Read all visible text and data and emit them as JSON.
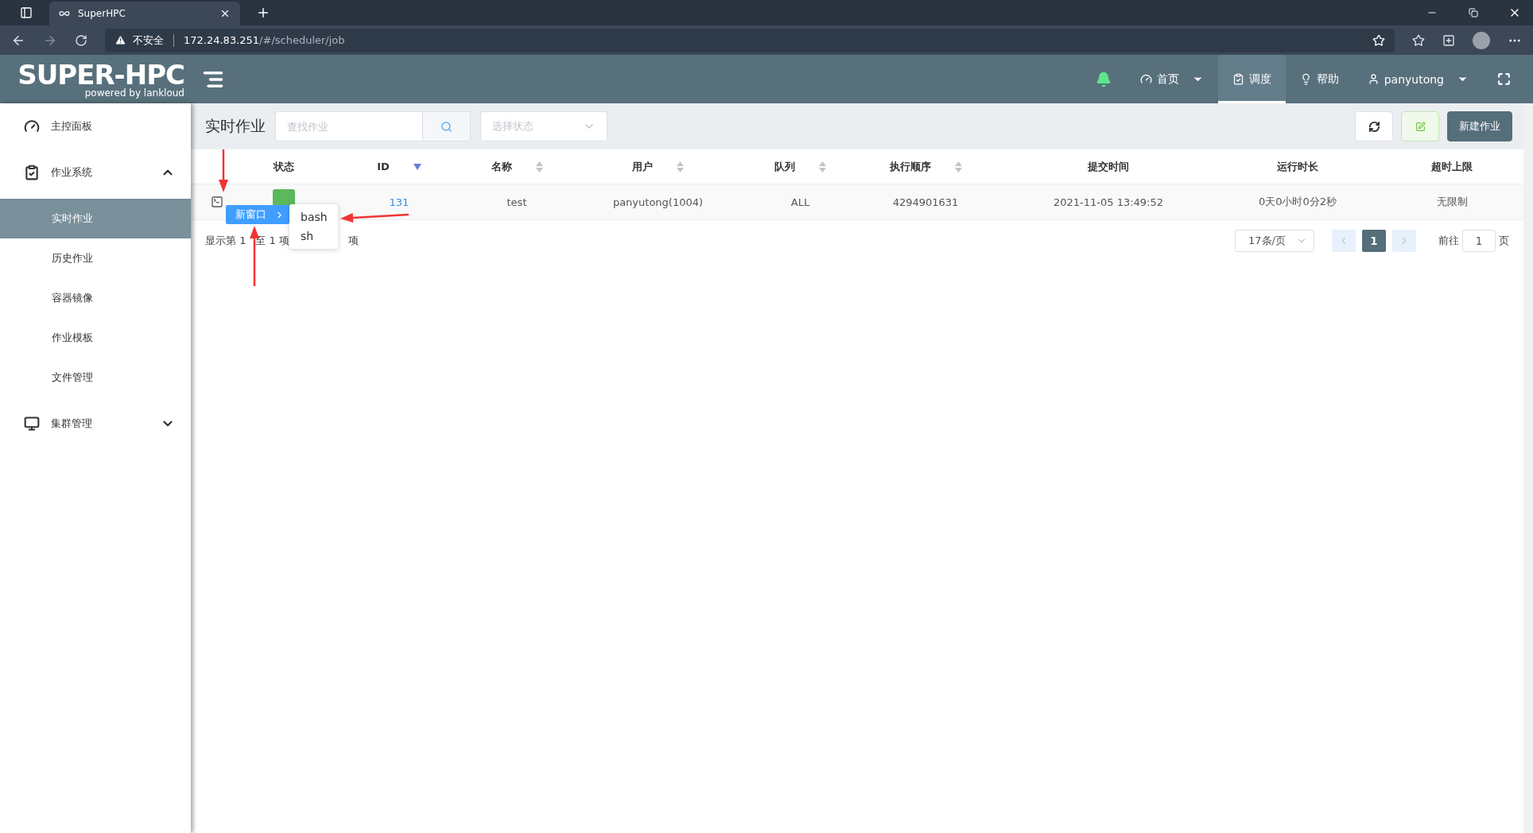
{
  "browser": {
    "tab_title": "SuperHPC",
    "security_label": "不安全",
    "url_host": "172.24.83.251",
    "url_path": "/#/scheduler/job"
  },
  "app": {
    "logo": "SUPER-HPC",
    "logo_sub": "powered by lankloud"
  },
  "nav": [
    {
      "kind": "bell"
    },
    {
      "kind": "home",
      "label": "首页",
      "dropdown": true,
      "selected": false
    },
    {
      "kind": "schedule",
      "label": "调度",
      "dropdown": false,
      "selected": true
    },
    {
      "kind": "help",
      "label": "帮助",
      "dropdown": false,
      "selected": false
    },
    {
      "kind": "user",
      "label": "panyutong",
      "dropdown": true,
      "selected": false
    },
    {
      "kind": "fullscreen"
    }
  ],
  "sidebar": {
    "items": [
      {
        "kind": "dashboard",
        "label": "主控面板"
      },
      {
        "kind": "jobs",
        "label": "作业系统",
        "expanded": true,
        "children": [
          {
            "label": "实时作业",
            "selected": true
          },
          {
            "label": "历史作业",
            "selected": false
          },
          {
            "label": "容器镜像",
            "selected": false
          },
          {
            "label": "作业模板",
            "selected": false
          },
          {
            "label": "文件管理",
            "selected": false
          }
        ]
      },
      {
        "kind": "cluster",
        "label": "集群管理",
        "expanded": false
      }
    ]
  },
  "page": {
    "title": "实时作业",
    "search": {
      "placeholder": "查找作业"
    },
    "status_select": {
      "placeholder": "选择状态"
    },
    "new_button": "新建作业"
  },
  "table": {
    "columns": [
      {
        "label": "状态"
      },
      {
        "label": "ID",
        "sortable": true,
        "sorted": true
      },
      {
        "label": "名称",
        "sortable": true,
        "sorted": false
      },
      {
        "label": "用户",
        "sortable": true,
        "sorted": false
      },
      {
        "label": "队列",
        "sortable": true,
        "sorted": false
      },
      {
        "label": "执行顺序",
        "sortable": true,
        "sorted": false
      },
      {
        "label": "提交时间"
      },
      {
        "label": "运行时长"
      },
      {
        "label": "超时上限"
      }
    ],
    "rows": [
      {
        "color": "#5cb85c",
        "id": "131",
        "name": "test",
        "user": "panyutong(1004)",
        "queue": "ALL",
        "order": "4294901631",
        "submitted": "2021-11-05 13:49:52",
        "duration": "0天0小时0分2秒",
        "timeout": "无限制"
      }
    ]
  },
  "context_menu": {
    "item": {
      "label": "新窗口",
      "selected": true
    },
    "submenu": [
      "bash",
      "sh"
    ]
  },
  "pagination": {
    "summary_parts": [
      "显示第 1",
      "至 1 项",
      "项"
    ],
    "page_size": "17条/页",
    "pages": [
      {
        "label": "1",
        "selected": true
      }
    ],
    "goto_label": "前往",
    "goto_value": "1",
    "goto_suffix": "页"
  }
}
